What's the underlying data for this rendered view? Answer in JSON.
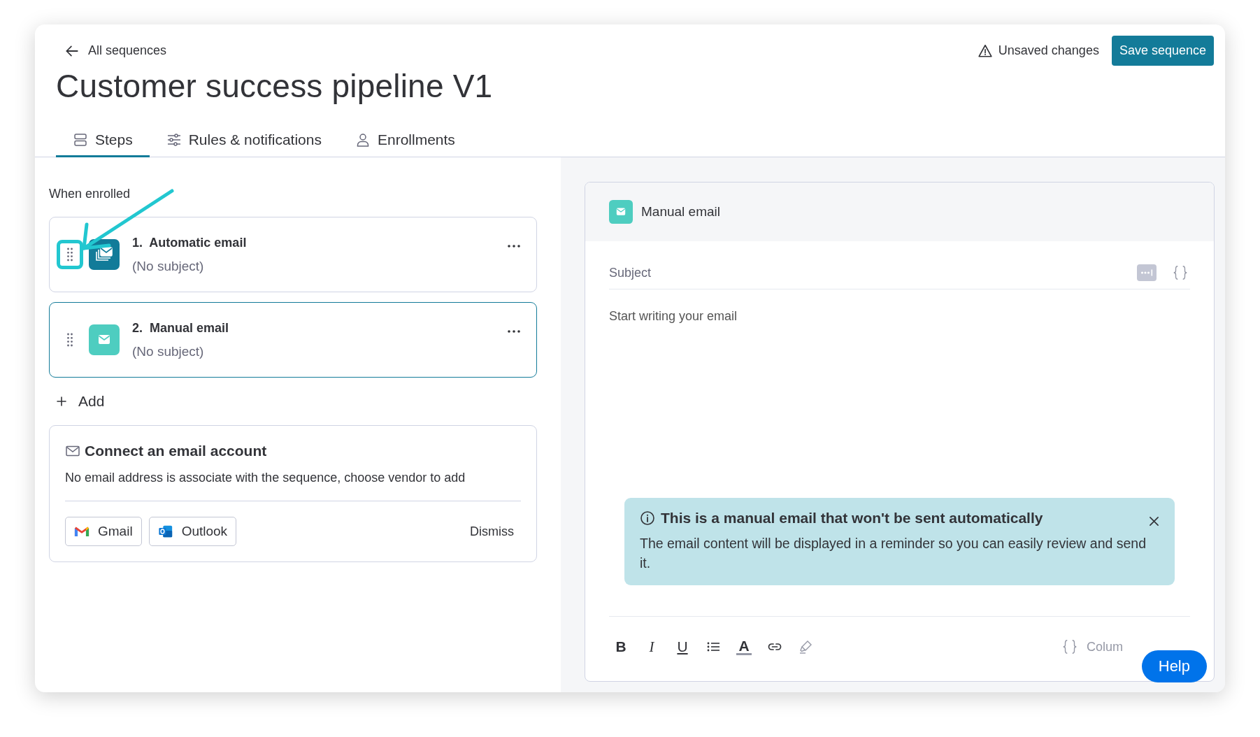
{
  "header": {
    "back_link": "All sequences",
    "title": "Customer success pipeline V1",
    "unsaved_notice": "Unsaved changes",
    "save_button": "Save sequence"
  },
  "tabs": [
    {
      "label": "Steps",
      "kind": "steps",
      "selected": true
    },
    {
      "label": "Rules & notifications",
      "kind": "rules",
      "selected": false
    },
    {
      "label": "Enrollments",
      "kind": "enrollments",
      "selected": false
    }
  ],
  "steps_panel": {
    "trigger_label": "When enrolled",
    "steps": [
      {
        "number": "1.",
        "title": "Automatic email",
        "subtitle": "(No subject)",
        "kind": "automatic",
        "selected": false,
        "highlighted": true
      },
      {
        "number": "2.",
        "title": "Manual email",
        "subtitle": "(No subject)",
        "kind": "manual",
        "selected": true,
        "highlighted": false
      }
    ],
    "add_label": "Add",
    "connect_card": {
      "title": "Connect an email account",
      "message": "No email address is associate with the sequence, choose vendor to add",
      "vendors": [
        {
          "label": "Gmail",
          "kind": "gmail"
        },
        {
          "label": "Outlook",
          "kind": "outlook"
        }
      ],
      "dismiss": "Dismiss"
    }
  },
  "editor": {
    "title": "Manual email",
    "subject_placeholder": "Subject",
    "body_placeholder": "Start writing your email",
    "notice": {
      "title": "This is a manual email that won't be sent automatically",
      "text": "The email content will be displayed in a reminder so you can easily review and send it."
    },
    "toolbar": [
      {
        "kind": "bold",
        "glyph": "B"
      },
      {
        "kind": "italic",
        "glyph": "I"
      },
      {
        "kind": "underline",
        "glyph": "U"
      },
      {
        "kind": "list"
      },
      {
        "kind": "text-color",
        "glyph": "A"
      },
      {
        "kind": "link"
      },
      {
        "kind": "highlight"
      }
    ],
    "columns_label": "Colum"
  },
  "help_button": "Help"
}
